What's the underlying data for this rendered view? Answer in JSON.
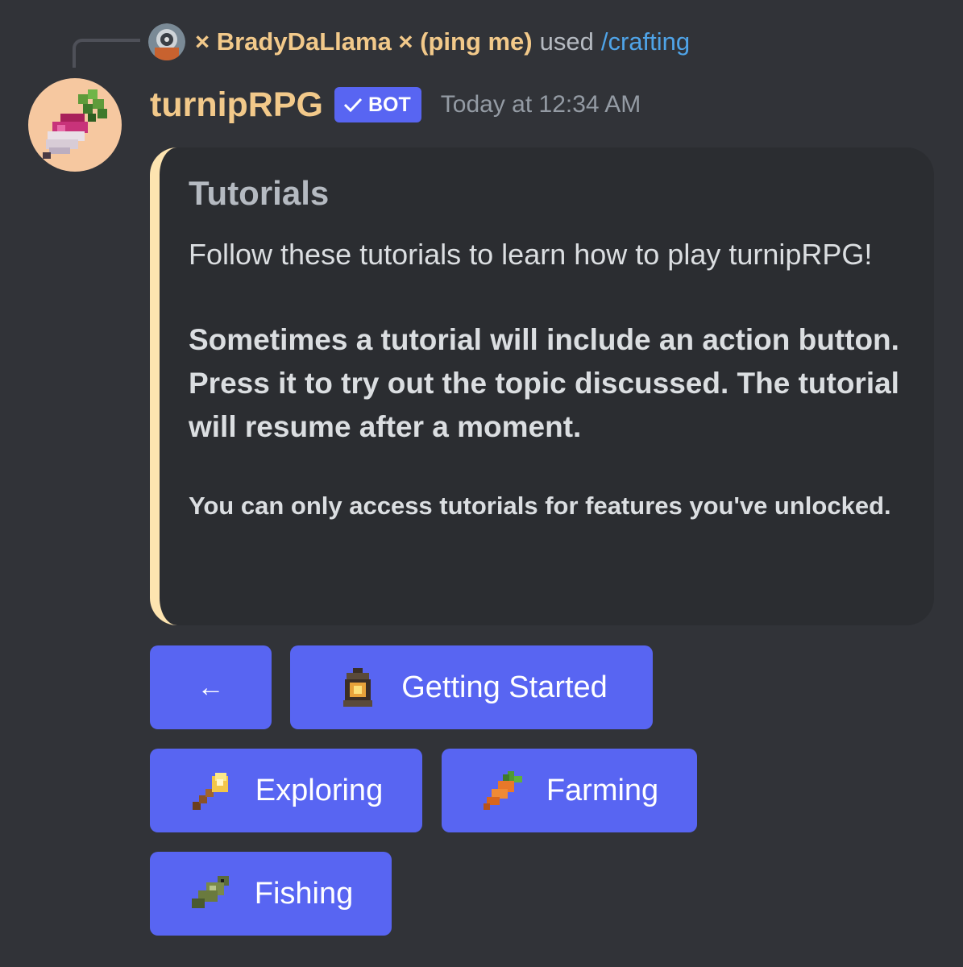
{
  "reply": {
    "username": "× BradyDaLlama × (ping me)",
    "used_text": "used",
    "command": "/crafting"
  },
  "message": {
    "author": "turnipRPG",
    "bot_tag": "BOT",
    "timestamp": "Today at 12:34 AM",
    "author_color": "#f2c98a",
    "accent_color": "#fde4b0"
  },
  "embed": {
    "title": "Tutorials",
    "paragraph1": "Follow these tutorials to learn how to play turnipRPG!",
    "paragraph2": "Sometimes a tutorial will include an action button. Press it to try out the topic discussed. The tutorial will resume after a moment.",
    "paragraph3": "You can only access tutorials for features you've unlocked."
  },
  "buttons": {
    "back": "←",
    "getting_started": "Getting Started",
    "exploring": "Exploring",
    "farming": "Farming",
    "fishing": "Fishing"
  },
  "icons": {
    "reply_avatar": "user-avatar-icon",
    "bot_avatar": "turnip-avatar-icon",
    "getting_started": "lantern-icon",
    "exploring": "torch-icon",
    "farming": "carrot-icon",
    "fishing": "fish-icon"
  }
}
